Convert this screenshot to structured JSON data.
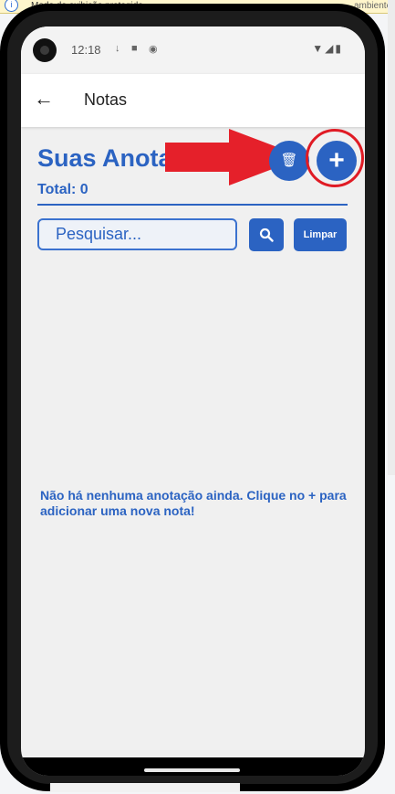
{
  "browser_banner": {
    "text": "Modo de exibição protegido",
    "text_tail": "ambientes d"
  },
  "status_bar": {
    "time": "12:18",
    "icons": [
      "download-icon",
      "sd-card-icon",
      "app-icon",
      "wifi-icon",
      "signal-icon",
      "battery-icon"
    ]
  },
  "app_bar": {
    "back_icon": "arrow-left-icon",
    "title": "Notas"
  },
  "header": {
    "heading": "Suas Anotações",
    "total": "Total: 0"
  },
  "actions": {
    "delete_icon": "trash-icon",
    "add_icon": "plus-icon"
  },
  "search": {
    "placeholder": "Pesquisar...",
    "search_icon": "magnifier-icon",
    "clear_label": "Limpar"
  },
  "empty_state": {
    "message": "Não há nenhuma anotação ainda. Clique no + para adicionar uma nova nota!"
  },
  "annotation": {
    "arrow_color": "#e5202a",
    "circle_color": "#e01b24"
  },
  "colors": {
    "primary": "#2b63c2",
    "background": "#f0f0f0"
  }
}
